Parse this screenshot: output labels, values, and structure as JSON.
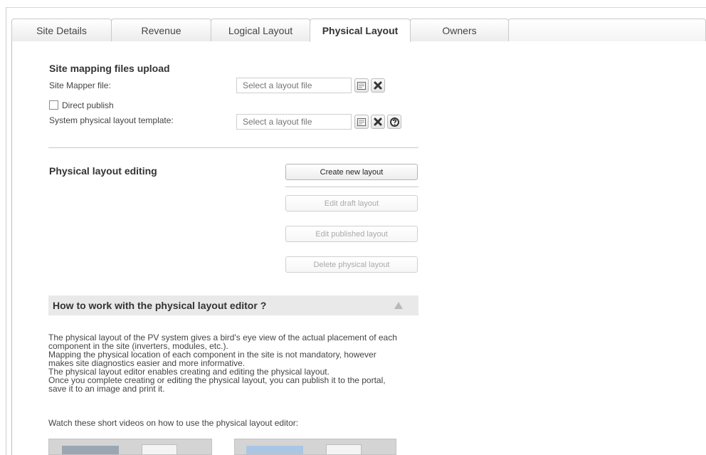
{
  "tabs": [
    {
      "label": "Site Details",
      "active": false
    },
    {
      "label": "Revenue",
      "active": false
    },
    {
      "label": "Logical Layout",
      "active": false
    },
    {
      "label": "Physical Layout",
      "active": true
    },
    {
      "label": "Owners",
      "active": false
    }
  ],
  "upload": {
    "title": "Site mapping files upload",
    "site_mapper_label": "Site Mapper file:",
    "site_mapper_placeholder": "Select a layout file",
    "direct_publish_label": "Direct publish",
    "direct_publish_checked": false,
    "template_label": "System physical layout template:",
    "template_placeholder": "Select a layout file"
  },
  "editing": {
    "title": "Physical layout editing",
    "create_label": "Create new layout",
    "edit_draft_label": "Edit draft layout",
    "edit_published_label": "Edit published layout",
    "delete_label": "Delete physical layout"
  },
  "howto": {
    "title": "How to work with the physical layout editor ?",
    "lines": [
      "The physical layout of the PV system gives a bird's eye view of the actual placement of each",
      "component in the site (inverters, modules, etc.).",
      "Mapping the physical location of each component in the site is not mandatory, however",
      "makes site diagnostics easier and more informative.",
      "The physical layout editor enables creating and editing the physical layout.",
      "Once you complete creating or editing the physical layout, you can publish it to the portal,",
      "save it to an image and print it."
    ],
    "videos_intro": "Watch these short videos on how to use the physical layout editor:"
  },
  "icons": {
    "browse": "browse-icon",
    "clear": "clear-icon",
    "help": "help-icon",
    "collapse": "collapse-arrow-icon"
  }
}
